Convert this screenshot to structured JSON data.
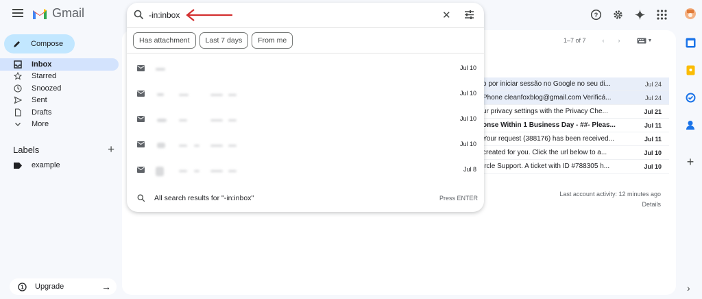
{
  "app": {
    "name": "Gmail"
  },
  "search": {
    "query": "-in:inbox",
    "chips": [
      "Has attachment",
      "Last 7 days",
      "From me"
    ],
    "results_dates": [
      "Jul 10",
      "Jul 10",
      "Jul 10",
      "Jul 10",
      "Jul 8"
    ],
    "all_results_label": "All search results for \"-in:inbox\"",
    "press_enter": "Press ENTER"
  },
  "sidebar": {
    "compose": "Compose",
    "items": [
      {
        "label": "Inbox",
        "icon": "inbox-icon",
        "active": true
      },
      {
        "label": "Starred",
        "icon": "star-icon"
      },
      {
        "label": "Snoozed",
        "icon": "clock-icon"
      },
      {
        "label": "Sent",
        "icon": "send-icon"
      },
      {
        "label": "Drafts",
        "icon": "draft-icon"
      },
      {
        "label": "More",
        "icon": "chevron-down-icon"
      }
    ],
    "labels_heading": "Labels",
    "labels": [
      "example"
    ],
    "upgrade": "Upgrade"
  },
  "main": {
    "pager": "1–7 of 7",
    "rows": [
      {
        "text": "o por iniciar sessão no Google no seu di...",
        "date": "Jul 24",
        "unread": false,
        "selected": true
      },
      {
        "text": "Phone cleanfoxblog@gmail.com Verificá...",
        "date": "Jul 24",
        "unread": false,
        "selected": true
      },
      {
        "text": "ur privacy settings with the Privacy Che...",
        "date": "Jul 21",
        "unread": true,
        "selected": false
      },
      {
        "text": "onse Within 1 Business Day - ##- Pleas...",
        "date": "Jul 11",
        "unread": true,
        "selected": false
      },
      {
        "text": "Your request (388176) has been received...",
        "date": "Jul 11",
        "unread": true,
        "selected": false
      },
      {
        "text": "created for you. Click the url below to a...",
        "date": "Jul 10",
        "unread": true,
        "selected": false
      },
      {
        "text": "ircle Support. A ticket with ID #788305 h...",
        "date": "Jul 10",
        "unread": true,
        "selected": false
      }
    ],
    "activity": "Last account activity: 12 minutes ago",
    "details": "Details"
  },
  "colors": {
    "accent": "#c2e7ff",
    "active_nav": "#d3e3fd",
    "arrow": "#d32f2f"
  }
}
